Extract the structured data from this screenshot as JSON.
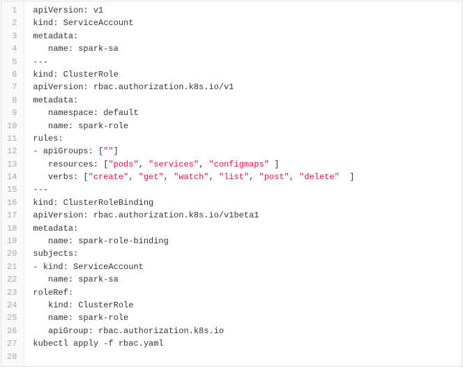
{
  "code": {
    "lines": [
      {
        "n": "1",
        "tokens": [
          {
            "t": "apiVersion:",
            "c": "key"
          },
          {
            "t": " v1",
            "c": "value"
          }
        ]
      },
      {
        "n": "2",
        "tokens": [
          {
            "t": "kind:",
            "c": "key"
          },
          {
            "t": " ServiceAccount",
            "c": "value"
          }
        ]
      },
      {
        "n": "3",
        "tokens": [
          {
            "t": "metadata:",
            "c": "key"
          }
        ]
      },
      {
        "n": "4",
        "tokens": [
          {
            "t": "   name:",
            "c": "key"
          },
          {
            "t": " spark-sa",
            "c": "value"
          }
        ]
      },
      {
        "n": "5",
        "tokens": [
          {
            "t": "---",
            "c": "value"
          }
        ]
      },
      {
        "n": "6",
        "tokens": [
          {
            "t": "kind:",
            "c": "key"
          },
          {
            "t": " ClusterRole",
            "c": "value"
          }
        ]
      },
      {
        "n": "7",
        "tokens": [
          {
            "t": "apiVersion:",
            "c": "key"
          },
          {
            "t": " rbac.authorization.k8s.io/v1",
            "c": "value"
          }
        ]
      },
      {
        "n": "8",
        "tokens": [
          {
            "t": "metadata:",
            "c": "key"
          }
        ]
      },
      {
        "n": "9",
        "tokens": [
          {
            "t": "   namespace:",
            "c": "key"
          },
          {
            "t": " default",
            "c": "value"
          }
        ]
      },
      {
        "n": "10",
        "tokens": [
          {
            "t": "   name:",
            "c": "key"
          },
          {
            "t": " spark-role",
            "c": "value"
          }
        ]
      },
      {
        "n": "11",
        "tokens": [
          {
            "t": "rules:",
            "c": "key"
          }
        ]
      },
      {
        "n": "12",
        "tokens": [
          {
            "t": "- apiGroups:",
            "c": "key"
          },
          {
            "t": " [",
            "c": "punct"
          },
          {
            "t": "\"\"",
            "c": "string"
          },
          {
            "t": "]",
            "c": "punct"
          }
        ]
      },
      {
        "n": "13",
        "tokens": [
          {
            "t": "   resources:",
            "c": "key"
          },
          {
            "t": " [",
            "c": "punct"
          },
          {
            "t": "\"pods\"",
            "c": "string"
          },
          {
            "t": ", ",
            "c": "punct"
          },
          {
            "t": "\"services\"",
            "c": "string"
          },
          {
            "t": ", ",
            "c": "punct"
          },
          {
            "t": "\"configmaps\"",
            "c": "string"
          },
          {
            "t": " ]",
            "c": "punct"
          }
        ]
      },
      {
        "n": "14",
        "tokens": [
          {
            "t": "   verbs:",
            "c": "key"
          },
          {
            "t": " [",
            "c": "punct"
          },
          {
            "t": "\"create\"",
            "c": "string"
          },
          {
            "t": ", ",
            "c": "punct"
          },
          {
            "t": "\"get\"",
            "c": "string"
          },
          {
            "t": ", ",
            "c": "punct"
          },
          {
            "t": "\"watch\"",
            "c": "string"
          },
          {
            "t": ", ",
            "c": "punct"
          },
          {
            "t": "\"list\"",
            "c": "string"
          },
          {
            "t": ", ",
            "c": "punct"
          },
          {
            "t": "\"post\"",
            "c": "string"
          },
          {
            "t": ", ",
            "c": "punct"
          },
          {
            "t": "\"delete\"",
            "c": "string"
          },
          {
            "t": "  ]",
            "c": "punct"
          }
        ]
      },
      {
        "n": "15",
        "tokens": [
          {
            "t": "---",
            "c": "value"
          }
        ]
      },
      {
        "n": "16",
        "tokens": [
          {
            "t": "kind:",
            "c": "key"
          },
          {
            "t": " ClusterRoleBinding",
            "c": "value"
          }
        ]
      },
      {
        "n": "17",
        "tokens": [
          {
            "t": "apiVersion:",
            "c": "key"
          },
          {
            "t": " rbac.authorization.k8s.io/v1beta1",
            "c": "value"
          }
        ]
      },
      {
        "n": "18",
        "tokens": [
          {
            "t": "metadata:",
            "c": "key"
          }
        ]
      },
      {
        "n": "19",
        "tokens": [
          {
            "t": "   name:",
            "c": "key"
          },
          {
            "t": " spark-role-binding",
            "c": "value"
          }
        ]
      },
      {
        "n": "20",
        "tokens": [
          {
            "t": "subjects:",
            "c": "key"
          }
        ]
      },
      {
        "n": "21",
        "tokens": [
          {
            "t": "- kind:",
            "c": "key"
          },
          {
            "t": " ServiceAccount",
            "c": "value"
          }
        ]
      },
      {
        "n": "22",
        "tokens": [
          {
            "t": "   name:",
            "c": "key"
          },
          {
            "t": " spark-sa",
            "c": "value"
          }
        ]
      },
      {
        "n": "23",
        "tokens": [
          {
            "t": "roleRef:",
            "c": "key"
          }
        ]
      },
      {
        "n": "24",
        "tokens": [
          {
            "t": "   kind:",
            "c": "key"
          },
          {
            "t": " ClusterRole",
            "c": "value"
          }
        ]
      },
      {
        "n": "25",
        "tokens": [
          {
            "t": "   name:",
            "c": "key"
          },
          {
            "t": " spark-role",
            "c": "value"
          }
        ]
      },
      {
        "n": "26",
        "tokens": [
          {
            "t": "   apiGroup:",
            "c": "key"
          },
          {
            "t": " rbac.authorization.k8s.io",
            "c": "value"
          }
        ]
      },
      {
        "n": "27",
        "tokens": [
          {
            "t": "kubectl apply -f rbac.yaml",
            "c": "value"
          }
        ]
      },
      {
        "n": "28",
        "tokens": []
      }
    ]
  }
}
